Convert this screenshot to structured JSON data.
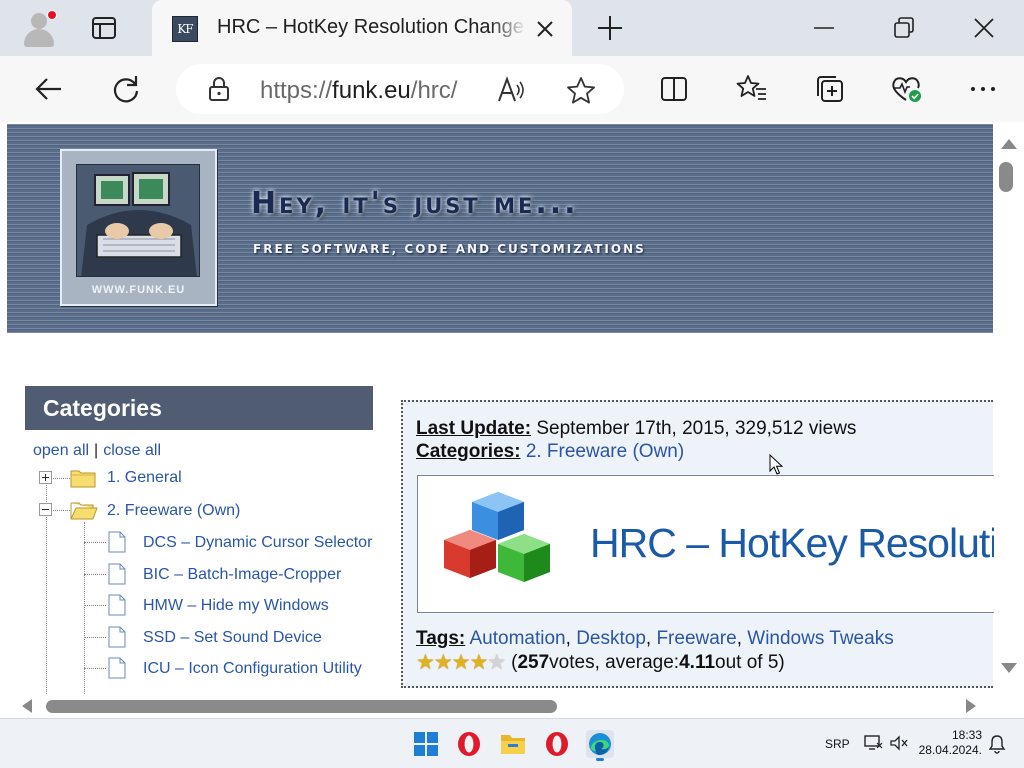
{
  "browser": {
    "tab": {
      "favicon_text": "KF",
      "title": "HRC – HotKey Resolution Change"
    },
    "address_bar": {
      "scheme": "https://",
      "host": "funk.eu",
      "path": "/hrc/"
    },
    "icons": {
      "profile": "profile-avatar-icon",
      "tab_actions": "tab-actions-icon",
      "close_tab": "close-icon",
      "new_tab": "plus-icon",
      "minimize": "minimize-icon",
      "restore": "restore-icon",
      "close_window": "close-icon",
      "back": "back-arrow-icon",
      "refresh": "refresh-icon",
      "lock": "lock-icon",
      "read_aloud": "read-aloud-icon",
      "favorite": "star-icon",
      "split_screen": "split-screen-icon",
      "favorites": "favorites-icon",
      "collections": "collections-icon",
      "browser_essentials": "heart-pulse-icon",
      "more": "more-icon"
    }
  },
  "page": {
    "banner": {
      "title": "Hey, it's just me...",
      "subtitle": "Free software, code and customizations",
      "logo_domain": "WWW.FUNK.EU"
    },
    "sidebar": {
      "header": "Categories",
      "open_all": "open all",
      "separator": "|",
      "close_all": "close all",
      "tree": [
        {
          "label": "1. General",
          "type": "folder",
          "expanded": false
        },
        {
          "label": "2. Freeware (Own)",
          "type": "folder",
          "expanded": true
        },
        {
          "label": "DCS – Dynamic Cursor Selector",
          "type": "page"
        },
        {
          "label": "BIC – Batch-Image-Cropper",
          "type": "page"
        },
        {
          "label": "HMW – Hide my Windows",
          "type": "page"
        },
        {
          "label": "SSD – Set Sound Device",
          "type": "page"
        },
        {
          "label": "ICU – Icon Configuration Utility",
          "type": "page"
        }
      ]
    },
    "article": {
      "last_update_label": "Last Update:",
      "last_update_value": "September 17th, 2015, 329,512 views",
      "categories_label": "Categories:",
      "categories_value": "2. Freeware (Own)",
      "program_title": "HRC – HotKey Resoluti",
      "tags_label": "Tags:",
      "tags": [
        "Automation",
        "Desktop",
        "Freeware",
        "Windows Tweaks"
      ],
      "tag_separator": ", ",
      "rating": {
        "stars_filled": 4,
        "stars_total": 5,
        "open_paren": "(",
        "votes": "257",
        "votes_text": " votes, average: ",
        "average": "4.11",
        "out_of_text": " out of 5)"
      }
    }
  },
  "taskbar": {
    "apps": [
      "windows-start-icon",
      "opera-icon",
      "file-explorer-icon",
      "opera-icon",
      "edge-icon"
    ],
    "language": "SRP",
    "time": "18:33",
    "date": "28.04.2024."
  },
  "colors": {
    "titlebar": "#dfe3ea",
    "toolbar": "#f7f7f7",
    "banner": "#5a6e8c",
    "sidebar_header": "#505c72",
    "link": "#2a56a8",
    "program_title": "#1b5aa6",
    "star": "#e2b21c"
  }
}
